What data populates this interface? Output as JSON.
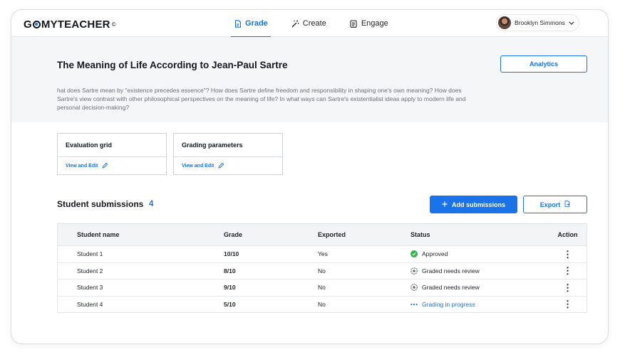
{
  "app": {
    "logo_text_left": "G",
    "logo_text_right": "MYTEACHER",
    "logo_mark": "©"
  },
  "nav": {
    "tabs": [
      {
        "label": "Grade",
        "icon": "document-icon",
        "active": true
      },
      {
        "label": "Create",
        "icon": "magic-wand-icon",
        "active": false
      },
      {
        "label": "Engage",
        "icon": "clipboard-icon",
        "active": false
      }
    ]
  },
  "user": {
    "name": "Brooklyn Simmons"
  },
  "assignment": {
    "title": "The Meaning of Life According to Jean-Paul Sartre",
    "description": "hat does Sartre mean by \"existence precedes essence\"? How does Sartre define freedom and responsibility in shaping one's own meaning? How does Sartre's view contrast with other philosophical perspectives on the meaning of life? In what ways can Sartre's existentialist ideas apply to modern life and personal decision-making?",
    "analytics_label": "Analytics"
  },
  "tools": [
    {
      "title": "Evaluation grid",
      "link": "View and Edit"
    },
    {
      "title": "Grading parameters",
      "link": "View and Edit"
    }
  ],
  "submissions": {
    "title": "Student submissions",
    "count": "4",
    "add_label": "Add submissions",
    "export_label": "Export",
    "columns": [
      "Student name",
      "Grade",
      "Exported",
      "Status",
      "Action"
    ],
    "rows": [
      {
        "name": "Student 1",
        "grade": "10/10",
        "exported": "Yes",
        "status": "Approved",
        "status_kind": "approved"
      },
      {
        "name": "Student 2",
        "grade": "8/10",
        "exported": "No",
        "status": "Graded needs review",
        "status_kind": "review"
      },
      {
        "name": "Student 3",
        "grade": "9/10",
        "exported": "No",
        "status": "Graded needs review",
        "status_kind": "review"
      },
      {
        "name": "Student 4",
        "grade": "5/10",
        "exported": "No",
        "status": "Grading in progress",
        "status_kind": "progress"
      }
    ]
  },
  "colors": {
    "accent": "#1a73e8",
    "approved": "#2fb34a",
    "hero_bg": "#f5f6f7"
  }
}
